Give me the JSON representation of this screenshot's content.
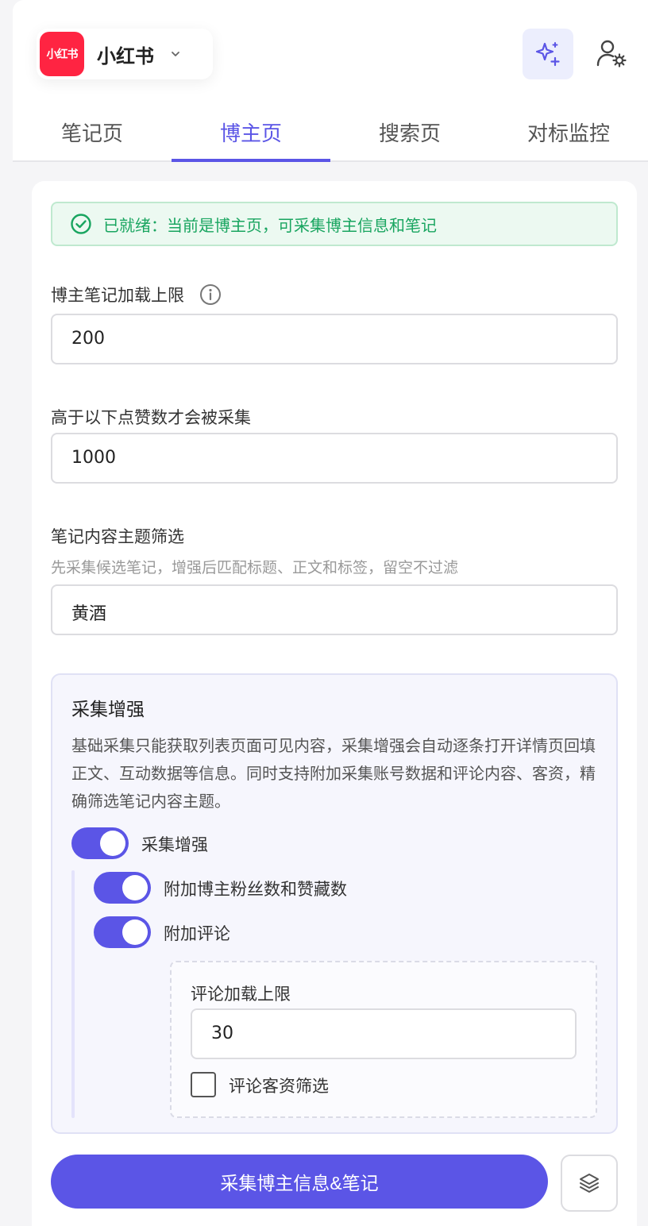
{
  "header": {
    "app_logo_text": "小红书",
    "app_name": "小红书",
    "icons": {
      "dropdown": "chevron-down-icon",
      "ai": "sparkles-icon",
      "user": "user-settings-icon"
    }
  },
  "tabs": [
    {
      "label": "笔记页",
      "active": false
    },
    {
      "label": "博主页",
      "active": true
    },
    {
      "label": "搜索页",
      "active": false
    },
    {
      "label": "对标监控",
      "active": false
    }
  ],
  "status": {
    "text": "已就绪：当前是博主页，可采集博主信息和笔记",
    "color": "#19a560"
  },
  "form": {
    "note_limit": {
      "label": "博主笔记加载上限",
      "value": "200"
    },
    "like_threshold": {
      "label": "高于以下点赞数才会被采集",
      "value": "1000"
    },
    "topic_filter": {
      "label": "笔记内容主题筛选",
      "hint": "先采集候选笔记，增强后匹配标题、正文和标签，留空不过滤",
      "value": "黄酒"
    }
  },
  "enhance": {
    "title": "采集增强",
    "description": "基础采集只能获取列表页面可见内容，采集增强会自动逐条打开详情页回填正文、互动数据等信息。同时支持附加采集账号数据和评论内容、客资，精确筛选笔记内容主题。",
    "toggles": [
      {
        "label": "采集增强",
        "on": true
      },
      {
        "label": "附加博主粉丝数和赞藏数",
        "on": true
      },
      {
        "label": "附加评论",
        "on": true
      }
    ],
    "comments": {
      "limit_label": "评论加载上限",
      "limit_value": "30",
      "lead_filter_label": "评论客资筛选",
      "lead_filter_checked": false
    }
  },
  "actions": {
    "primary_label": "采集博主信息&笔记",
    "secondary_icon": "layers-icon"
  },
  "colors": {
    "accent": "#5b55e6",
    "brand": "#ff2442",
    "success": "#19a560"
  }
}
